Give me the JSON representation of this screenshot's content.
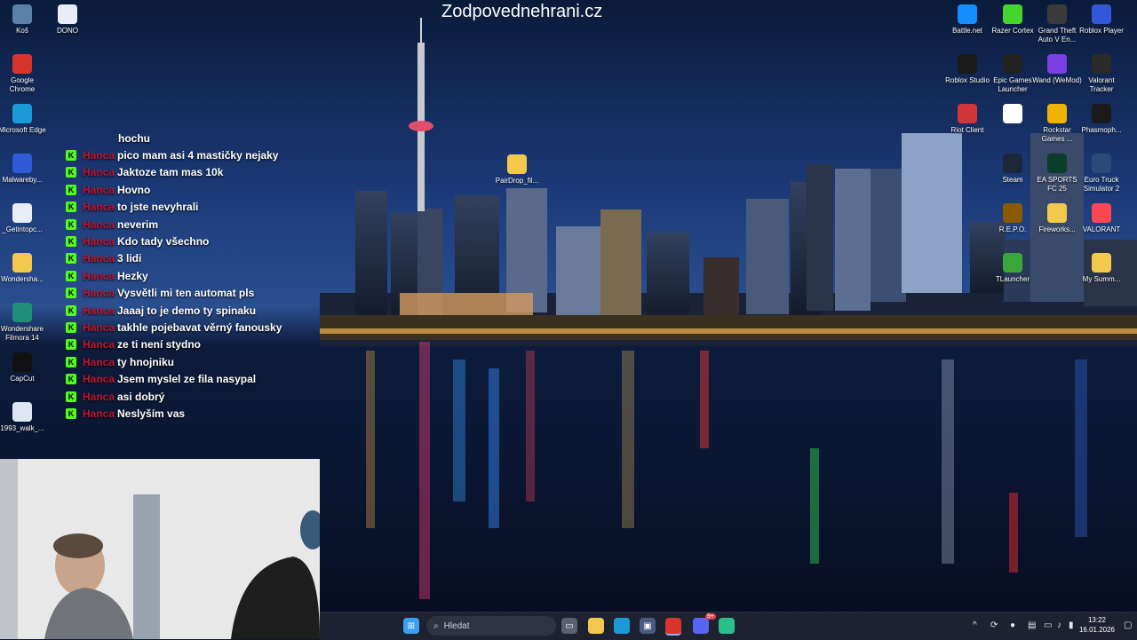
{
  "watermark": "Zodpovednehrani.cz",
  "desktop_left": [
    {
      "label": "Koš",
      "icon": "recycle-bin-icon",
      "color": "#5a7fa8"
    },
    {
      "label": "DONO",
      "icon": "file-icon",
      "color": "#e8eef7"
    },
    {
      "label": "Google Chrome",
      "icon": "chrome-icon",
      "color": "#d7352b"
    },
    {
      "label": "Microsoft Edge",
      "icon": "edge-icon",
      "color": "#1a9bd8"
    },
    {
      "label": "Malwareby...",
      "icon": "malwarebytes-icon",
      "color": "#2f5bd8"
    },
    {
      "label": "_Getintopc...",
      "icon": "file-icon",
      "color": "#e8eef7"
    },
    {
      "label": "Wondersha...",
      "icon": "folder-icon",
      "color": "#f2c94c"
    },
    {
      "label": "Wondershare Filmora 14",
      "icon": "filmora-icon",
      "color": "#1f8f7a"
    },
    {
      "label": "CapCut",
      "icon": "capcut-icon",
      "color": "#111111"
    },
    {
      "label": "1993_walk_...",
      "icon": "image-file-icon",
      "color": "#dde6f2"
    }
  ],
  "desktop_mid": {
    "label": "PairDrop_fil...",
    "icon": "folder-icon",
    "color": "#f2c94c"
  },
  "desktop_right": [
    {
      "label": "Battle.net",
      "icon": "battlenet-icon",
      "color": "#148eff"
    },
    {
      "label": "Razer Cortex",
      "icon": "razer-icon",
      "color": "#44d62c"
    },
    {
      "label": "Grand Theft Auto V En...",
      "icon": "gta-icon",
      "color": "#3a3a3a"
    },
    {
      "label": "Roblox Player",
      "icon": "roblox-icon",
      "color": "#3456d8"
    },
    {
      "label": "Roblox Studio",
      "icon": "roblox-studio-icon",
      "color": "#1a1a1a"
    },
    {
      "label": "Epic Games Launcher",
      "icon": "epic-icon",
      "color": "#222222"
    },
    {
      "label": "Wand (WeMod)",
      "icon": "wand-icon",
      "color": "#7b3fe4"
    },
    {
      "label": "Valorant Tracker",
      "icon": "valorant-tracker-icon",
      "color": "#2a2a2a"
    },
    {
      "label": "Riot Client",
      "icon": "riot-icon",
      "color": "#d13639"
    },
    {
      "label": "",
      "icon": "media-icon",
      "color": "#ffffff"
    },
    {
      "label": "Rockstar Games ...",
      "icon": "rockstar-icon",
      "color": "#f0b400"
    },
    {
      "label": "Phasmoph...",
      "icon": "phasmophobia-icon",
      "color": "#1a1a1a"
    },
    {
      "label": "Steam",
      "icon": "steam-icon",
      "color": "#1b2838"
    },
    {
      "label": "EA SPORTS FC 25",
      "icon": "easports-icon",
      "color": "#0a3d2a"
    },
    {
      "label": "Euro Truck Simulator 2",
      "icon": "ets2-icon",
      "color": "#2b4a7a"
    },
    {
      "label": "R.E.P.O.",
      "icon": "repo-icon",
      "color": "#8a5a00"
    },
    {
      "label": "Fireworks...",
      "icon": "folder-icon",
      "color": "#f2c94c"
    },
    {
      "label": "VALORANT",
      "icon": "valorant-icon",
      "color": "#ff4655"
    },
    {
      "label": "TLauncher",
      "icon": "tlauncher-icon",
      "color": "#3aa63a"
    },
    {
      "label": "My Summ...",
      "icon": "folder-icon",
      "color": "#f2c94c"
    }
  ],
  "chat": [
    {
      "user": "",
      "message": "hochu",
      "badge": false
    },
    {
      "user": "Hanca",
      "message": "pico mam asi 4 mastičky nejaky",
      "badge": true
    },
    {
      "user": "Hanca",
      "message": "Jaktoze tam mas 10k",
      "badge": true
    },
    {
      "user": "Hanca",
      "message": "Hovno",
      "badge": true
    },
    {
      "user": "Hanca",
      "message": "to jste nevyhrali",
      "badge": true
    },
    {
      "user": "Hanca",
      "message": "neverim",
      "badge": true
    },
    {
      "user": "Hanca",
      "message": "Kdo tady všechno",
      "badge": true
    },
    {
      "user": "Hanca",
      "message": "3 lidi",
      "badge": true
    },
    {
      "user": "Hanca",
      "message": "Hezky",
      "badge": true
    },
    {
      "user": "Hanca",
      "message": "Vysvětli mi ten automat pls",
      "badge": true
    },
    {
      "user": "Hanca",
      "message": "Jaaaj to je demo ty spinaku",
      "badge": true
    },
    {
      "user": "Hanca",
      "message": "takhle pojebavat věrný fanousky",
      "badge": true
    },
    {
      "user": "Hanca",
      "message": "ze ti není stydno",
      "badge": true
    },
    {
      "user": "Hanca",
      "message": "ty hnojniku",
      "badge": true
    },
    {
      "user": "Hanca",
      "message": "Jsem myslel ze fila nasypal",
      "badge": true
    },
    {
      "user": "Hanca",
      "message": "asi dobrý",
      "badge": true
    },
    {
      "user": "Hanca",
      "message": "Neslyším vas",
      "badge": true
    }
  ],
  "taskbar": {
    "search_placeholder": "Hledat",
    "time": "13:22",
    "date": "16.01.2026",
    "notification_badge": "9+"
  }
}
